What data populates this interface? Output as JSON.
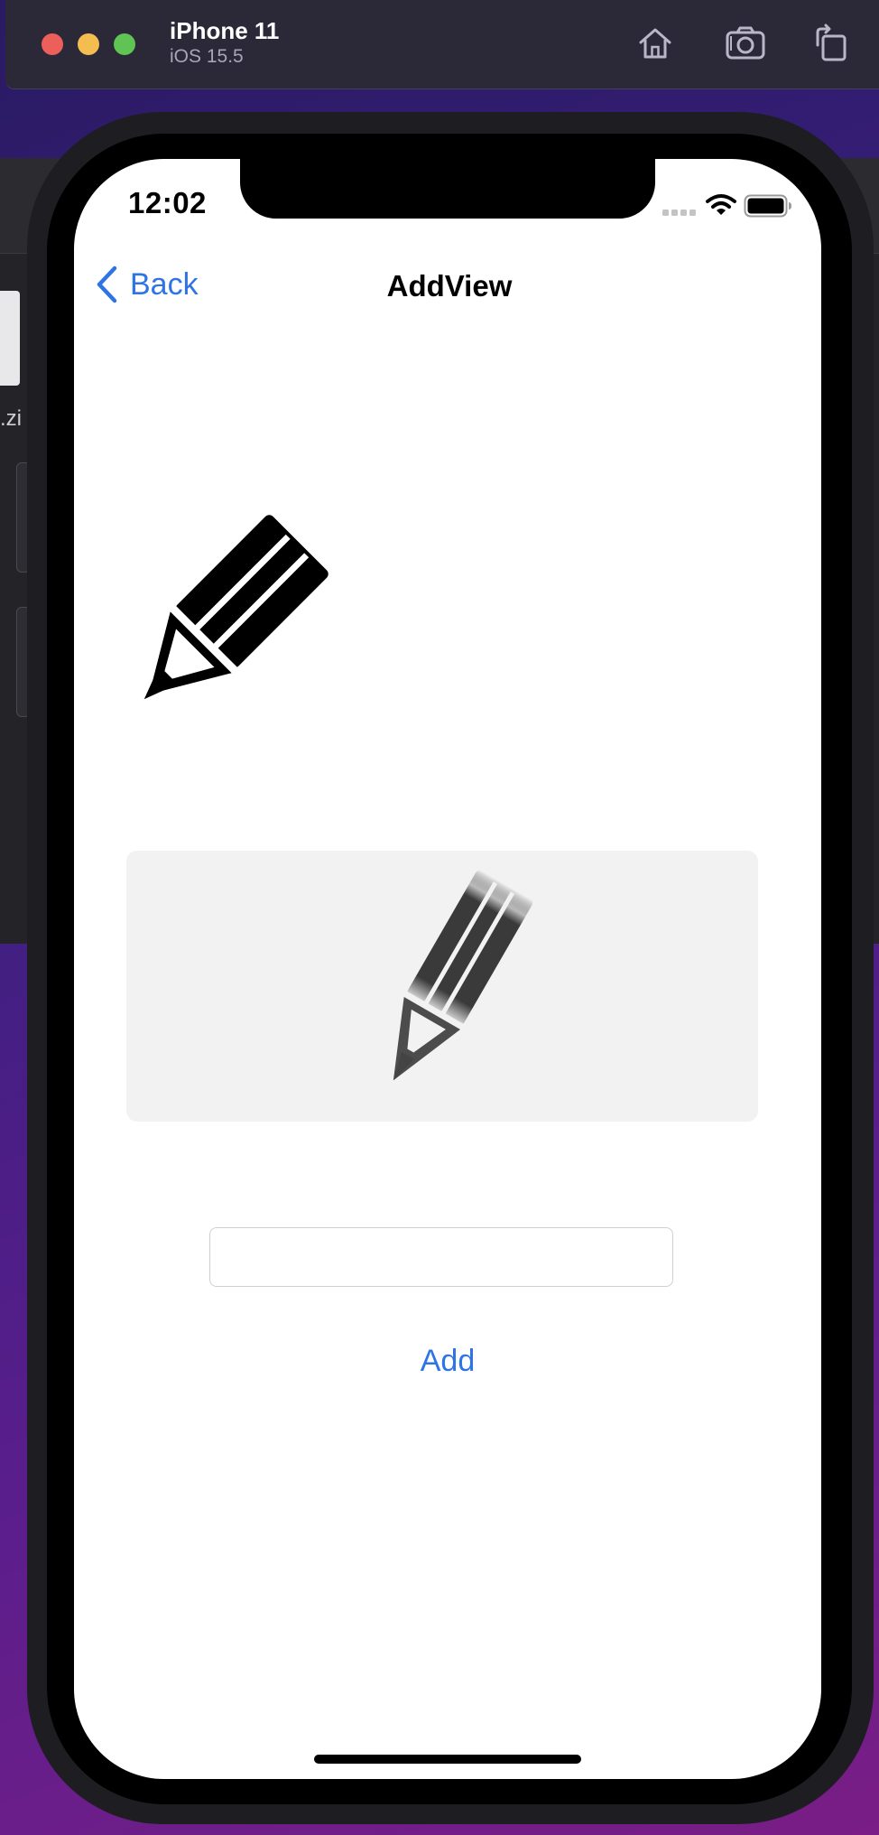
{
  "simulator": {
    "device_name": "iPhone 11",
    "os_version": "iOS 15.5",
    "icons": [
      "home-icon",
      "screenshot-icon",
      "rotate-icon"
    ]
  },
  "background": {
    "file_label": ".zi"
  },
  "status_bar": {
    "time": "12:02"
  },
  "nav": {
    "back_label": "Back",
    "title": "AddView"
  },
  "content": {
    "large_image_icon": "pencil-icon",
    "picker_image_icon": "pencil-icon",
    "text_field_value": "",
    "text_field_placeholder": "",
    "add_label": "Add"
  },
  "colors": {
    "accent": "#2f74e4",
    "image_well": "#f2f2f2"
  }
}
